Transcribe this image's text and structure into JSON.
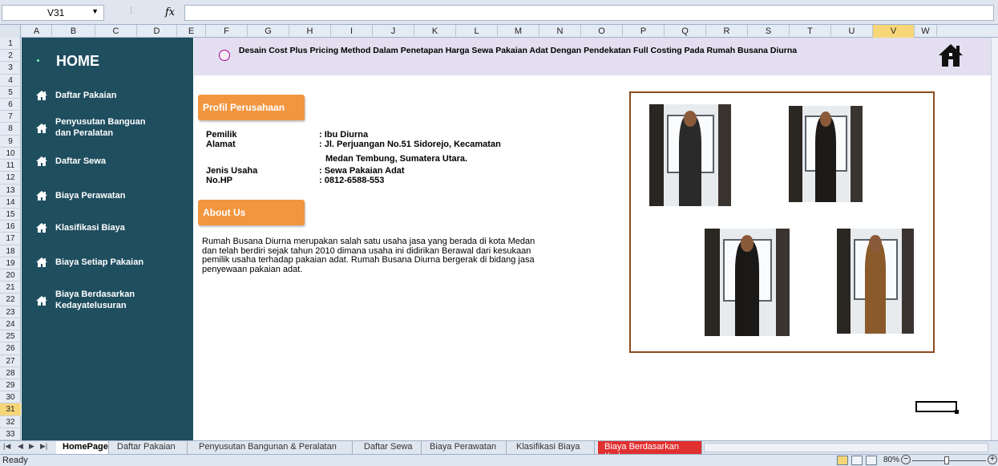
{
  "formula_bar": {
    "name_box": "V31",
    "fx_label": "fx",
    "formula": ""
  },
  "columns": [
    "A",
    "B",
    "C",
    "D",
    "E",
    "F",
    "G",
    "H",
    "I",
    "J",
    "K",
    "L",
    "M",
    "N",
    "O",
    "P",
    "Q",
    "R",
    "S",
    "T",
    "U",
    "V",
    "W"
  ],
  "selected_column": "V",
  "rows": [
    "1",
    "2",
    "3",
    "4",
    "5",
    "6",
    "7",
    "8",
    "9",
    "10",
    "11",
    "12",
    "13",
    "14",
    "15",
    "16",
    "17",
    "18",
    "19",
    "20",
    "21",
    "22",
    "23",
    "24",
    "25",
    "26",
    "27",
    "28",
    "29",
    "30",
    "31",
    "32",
    "33"
  ],
  "selected_row": "31",
  "sidebar": {
    "title": "HOME",
    "items": [
      {
        "label": "Daftar Pakaian",
        "icon": "home-icon"
      },
      {
        "label": "Penyusutan Banguan dan Peralatan",
        "icon": "home-icon"
      },
      {
        "label": "Daftar Sewa",
        "icon": "home-icon"
      },
      {
        "label": "Biaya Perawatan",
        "icon": "home-icon"
      },
      {
        "label": "Klasifikasi Biaya",
        "icon": "home-icon"
      },
      {
        "label": "Biaya Setiap Pakaian",
        "icon": "home-icon"
      },
      {
        "label": "Biaya Berdasarkan Kedayatelusuran",
        "icon": "home-icon"
      }
    ]
  },
  "banner": {
    "title": "Desain Cost Plus Pricing Method Dalam Penetapan Harga Sewa Pakaian Adat Dengan Pendekatan Full Costing Pada Rumah Busana Diurna",
    "home_icon": "home-icon",
    "seal_icon": "university-seal-icon"
  },
  "profile": {
    "heading": "Profil Perusahaan",
    "fields": [
      {
        "label": "Pemilik",
        "value": ": Ibu Diurna"
      },
      {
        "label": "Alamat",
        "value": ": Jl. Perjuangan No.51 Sidorejo, Kecamatan"
      },
      {
        "label": "",
        "value": "Medan Tembung, Sumatera Utara."
      },
      {
        "label": "Jenis Usaha",
        "value": ": Sewa Pakaian Adat"
      },
      {
        "label": "No.HP",
        "value": ": 0812-6588-553"
      }
    ]
  },
  "about": {
    "heading": "About Us",
    "lines": [
      "Rumah Busana Diurna merupakan salah satu usaha jasa yang berada di kota Medan",
      "dan telah berdiri  sejak tahun 2010 dimana usaha ini didirikan Berawal dari kesukaan",
      "pemilik usaha terhadap pakaian adat. Rumah Busana Diurna bergerak di bidang jasa",
      "penyewaan pakaian adat."
    ]
  },
  "photos": [
    {
      "name": "costume-photo-1",
      "outfit_color": "#2b2a2a"
    },
    {
      "name": "costume-photo-2",
      "outfit_color": "#1d1b1a"
    },
    {
      "name": "costume-photo-3",
      "outfit_color": "#1b1818"
    },
    {
      "name": "costume-photo-4",
      "outfit_color": "#8a5a2b"
    }
  ],
  "sheet_tabs": [
    {
      "label": "HomePage",
      "state": "active"
    },
    {
      "label": "Daftar Pakaian",
      "state": "normal"
    },
    {
      "label": "Penyusutan Bangunan & Peralatan",
      "state": "normal"
    },
    {
      "label": "Daftar Sewa",
      "state": "normal"
    },
    {
      "label": "Biaya Perawatan",
      "state": "normal"
    },
    {
      "label": "Klasifikasi Biaya",
      "state": "normal"
    },
    {
      "label": "Biaya Berdasarkan Ked",
      "state": "red"
    }
  ],
  "status": {
    "text": "Ready",
    "zoom": "80%"
  },
  "colors": {
    "sidebar": "#1f4e5f",
    "accent_orange": "#f29640",
    "banner": "#e3dff0",
    "frame_border": "#8c4a1e",
    "selected_header": "#f7d678"
  }
}
